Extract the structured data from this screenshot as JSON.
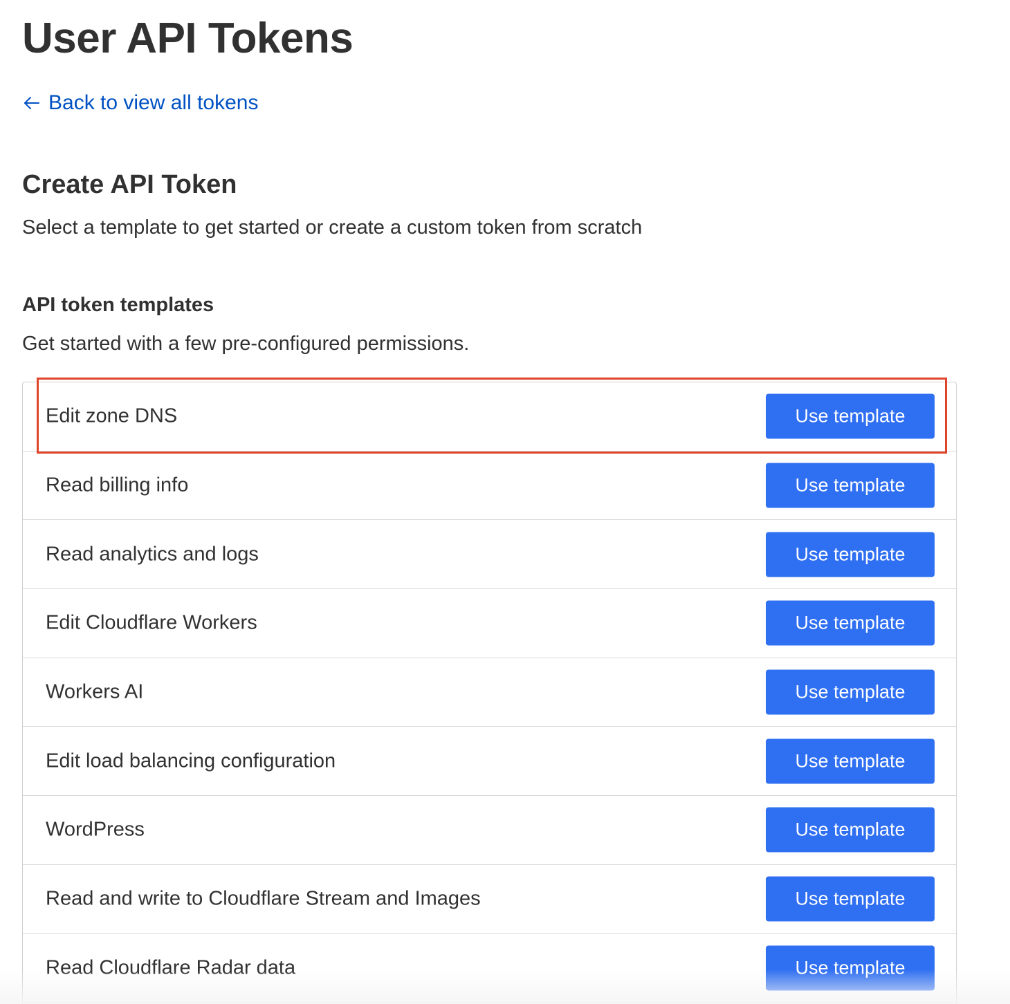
{
  "page": {
    "title": "User API Tokens",
    "back_link": "Back to view all tokens",
    "back_icon": "arrow-left-icon"
  },
  "create": {
    "title": "Create API Token",
    "subtitle": "Select a template to get started or create a custom token from scratch"
  },
  "templates": {
    "heading": "API token templates",
    "description": "Get started with a few pre-configured permissions.",
    "items": [
      {
        "name": "Edit zone DNS",
        "button": "Use template"
      },
      {
        "name": "Read billing info",
        "button": "Use template"
      },
      {
        "name": "Read analytics and logs",
        "button": "Use template"
      },
      {
        "name": "Edit Cloudflare Workers",
        "button": "Use template"
      },
      {
        "name": "Workers AI",
        "button": "Use template"
      },
      {
        "name": "Edit load balancing configuration",
        "button": "Use template"
      },
      {
        "name": "WordPress",
        "button": "Use template"
      },
      {
        "name": "Read and write to Cloudflare Stream and Images",
        "button": "Use template"
      },
      {
        "name": "Read Cloudflare Radar data",
        "button": "Use template"
      }
    ]
  },
  "colors": {
    "link": "#0051c3",
    "button": "#2f6ff2",
    "highlight": "#e0442a",
    "text": "#313131"
  }
}
